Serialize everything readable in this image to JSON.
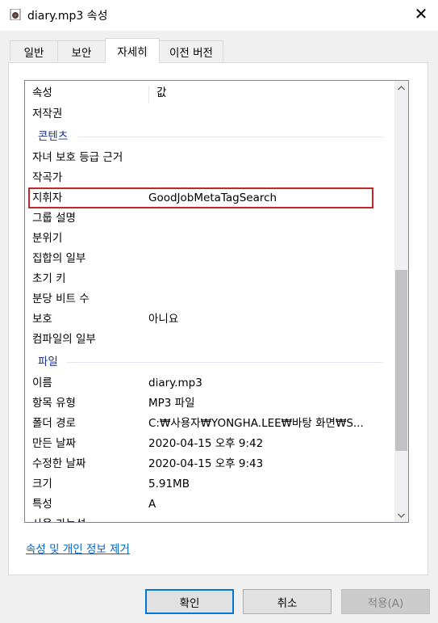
{
  "window": {
    "title": "diary.mp3 속성",
    "icon": "media-file-icon",
    "close_icon": "close-icon"
  },
  "tabs": [
    {
      "label": "일반",
      "active": false
    },
    {
      "label": "보안",
      "active": false
    },
    {
      "label": "자세히",
      "active": true
    },
    {
      "label": "이전 버전",
      "active": false
    }
  ],
  "details": {
    "header": {
      "property": "속성",
      "value": "값"
    },
    "rows_top": [
      {
        "property": "저작권",
        "value": ""
      }
    ],
    "group_content": "콘텐츠",
    "content_rows": [
      {
        "property": "자녀 보호 등급 근거",
        "value": ""
      },
      {
        "property": "작곡가",
        "value": ""
      },
      {
        "property": "지휘자",
        "value": "GoodJobMetaTagSearch"
      },
      {
        "property": "그룹 설명",
        "value": ""
      },
      {
        "property": "분위기",
        "value": ""
      },
      {
        "property": "집합의 일부",
        "value": ""
      },
      {
        "property": "초기 키",
        "value": ""
      },
      {
        "property": "분당 비트 수",
        "value": ""
      },
      {
        "property": "보호",
        "value": "아니요"
      },
      {
        "property": "컴파일의 일부",
        "value": ""
      }
    ],
    "group_file": "파일",
    "file_rows": [
      {
        "property": "이름",
        "value": "diary.mp3"
      },
      {
        "property": "항목 유형",
        "value": "MP3 파일"
      },
      {
        "property": "폴더 경로",
        "value": "C:₩사용자₩YONGHA.LEE₩바탕 화면₩S..."
      },
      {
        "property": "만든 날짜",
        "value": "2020-04-15 오후 9:42"
      },
      {
        "property": "수정한 날짜",
        "value": "2020-04-15 오후 9:43"
      },
      {
        "property": "크기",
        "value": "5.91MB"
      },
      {
        "property": "특성",
        "value": "A"
      },
      {
        "property": "사용 가능성",
        "value": ""
      }
    ]
  },
  "link_remove": "속성 및 개인 정보 제거",
  "buttons": {
    "ok": "확인",
    "cancel": "취소",
    "apply": "적용(A)"
  },
  "colors": {
    "highlight_border": "#c0282d",
    "group_text": "#1e3287",
    "link": "#0066cc",
    "default_button_border": "#0078d7"
  }
}
